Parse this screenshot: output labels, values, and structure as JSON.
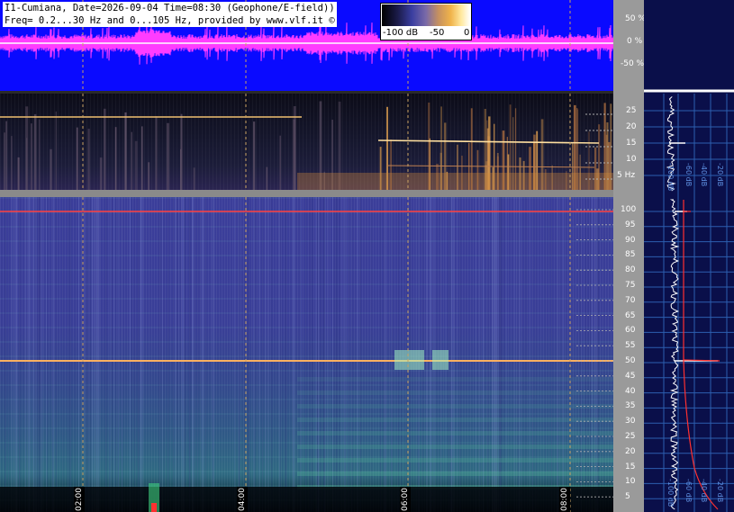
{
  "header": {
    "line1": "I1-Cumiana, Date=2026-09-04 Time=08:30 (Geophone/E-field))",
    "line2": "Freq= 0.2...30 Hz and 0...105 Hz, provided by www.vlf.it ©"
  },
  "colorbar": {
    "min_label": "-100 dB",
    "mid_label": "-50",
    "max_label": "0"
  },
  "wave_scale": [
    "50 %",
    "0 %",
    "-50 %"
  ],
  "low_freq_ticks": [
    "25",
    "20",
    "15",
    "10",
    "5 Hz"
  ],
  "high_freq_ticks": [
    "100",
    "95",
    "90",
    "85",
    "80",
    "75",
    "70",
    "65",
    "60",
    "55",
    "50",
    "45",
    "40",
    "35",
    "30",
    "25",
    "20",
    "15",
    "10",
    "5"
  ],
  "time_labels": [
    "02:00",
    "04:00",
    "06:00",
    "08:00"
  ],
  "spectrum_db_labels_top": [
    "-100 dB",
    "-60 dB",
    "-40 dB",
    "-20 dB"
  ],
  "spectrum_db_labels_bottom": [
    "-100 dB",
    "-60 dB",
    "-40 dB",
    "-20 dB"
  ],
  "colors": {
    "wave_bg": "#0a0aff",
    "wave_trace": "#ff3cff",
    "mains_line": "#ff4040",
    "panel_bg": "#0a0f4a",
    "grid": "#2c5fb0"
  }
}
